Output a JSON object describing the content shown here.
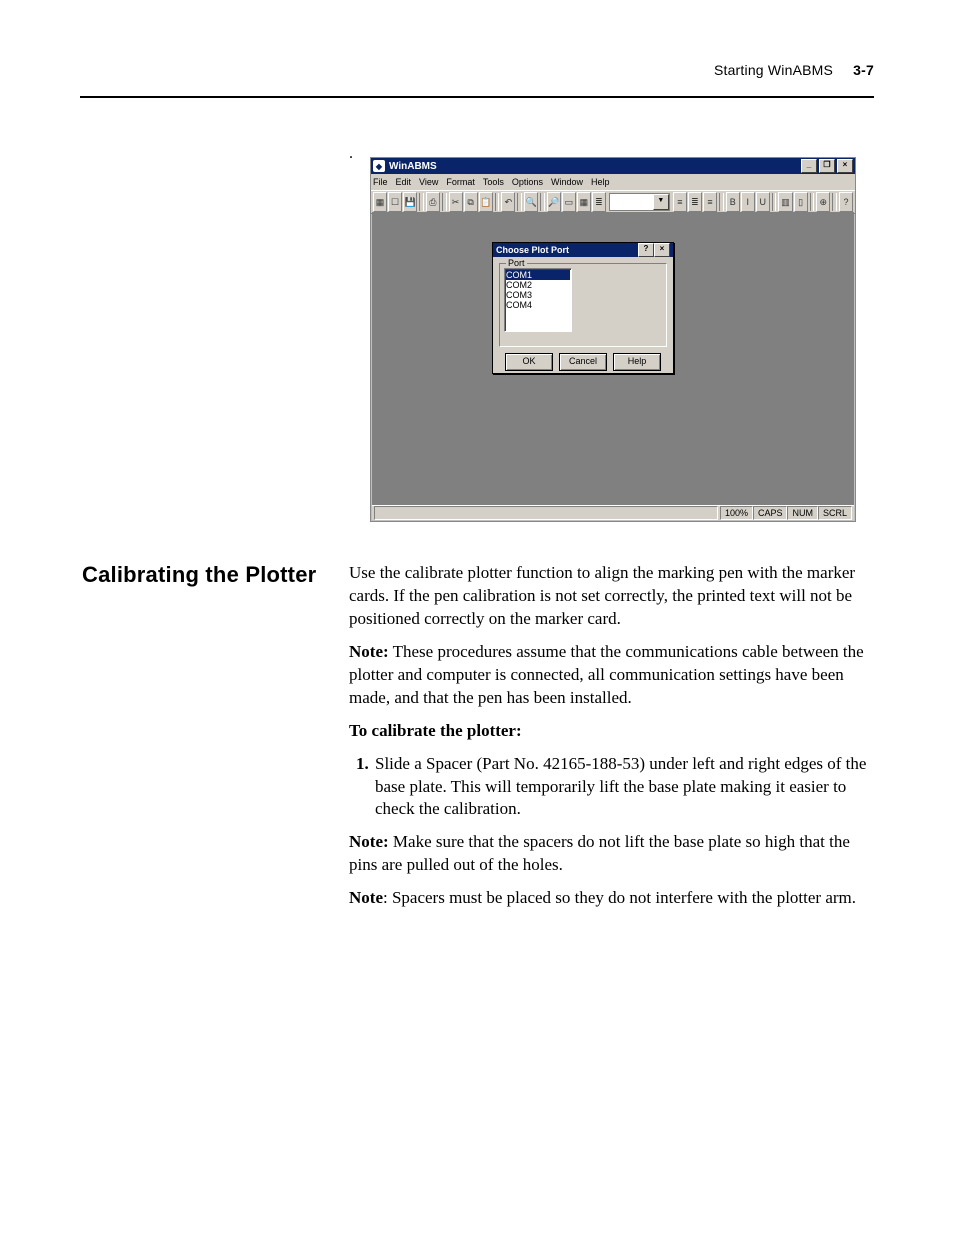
{
  "header": {
    "running_title": "Starting WinABMS",
    "page_number": "3-7"
  },
  "figure": {
    "lead_dot": ".",
    "app_title": "WinABMS",
    "window_controls": {
      "min": "_",
      "restore": "❐",
      "close": "×"
    },
    "menu": [
      "File",
      "Edit",
      "View",
      "Format",
      "Tools",
      "Options",
      "Window",
      "Help"
    ],
    "toolbar_icons": [
      "new-doc",
      "open-doc",
      "save-doc",
      "print",
      "cut",
      "copy",
      "paste",
      "undo",
      "redo",
      "zoom-in",
      "zoom-out",
      "fit",
      "grid",
      "align-left",
      "align-center",
      "align-right",
      "bold",
      "italic",
      "underline",
      "calibrate",
      "help"
    ],
    "combo_dropdown_glyph": "▼",
    "dialog": {
      "title": "Choose Plot Port",
      "help_glyph": "?",
      "close_glyph": "×",
      "group_label": "Port",
      "options": [
        "COM1",
        "COM2",
        "COM3",
        "COM4"
      ],
      "buttons": {
        "ok": "OK",
        "cancel": "Cancel",
        "help": "Help"
      }
    },
    "statusbar": {
      "zoom": "100%",
      "caps": "CAPS",
      "num": "NUM",
      "scrl": "SCRL"
    }
  },
  "sidehead": "Calibrating the Plotter",
  "body": {
    "p1": "Use the calibrate plotter function to align the marking pen with the marker cards.  If the pen calibration is not set correctly, the printed text will not be positioned correctly on the marker card.",
    "note1_label": "Note:",
    "note1_text": "  These procedures assume that the communications cable between the plotter and computer is connected, all communication settings have been made, and that the pen has been installed.",
    "procedure_title": "To calibrate the plotter:",
    "step1": "Slide a Spacer (Part No. 42165-188-53) under left and right edges of the base plate. This will temporarily lift the base plate making it easier to check the calibration.",
    "note2_label": "Note:",
    "note2_text": "  Make sure that the spacers do not lift the base plate so high that the pins are pulled out of the holes.",
    "note3_label": "Note",
    "note3_text": ": Spacers must be placed so they do not interfere with the plotter arm."
  }
}
